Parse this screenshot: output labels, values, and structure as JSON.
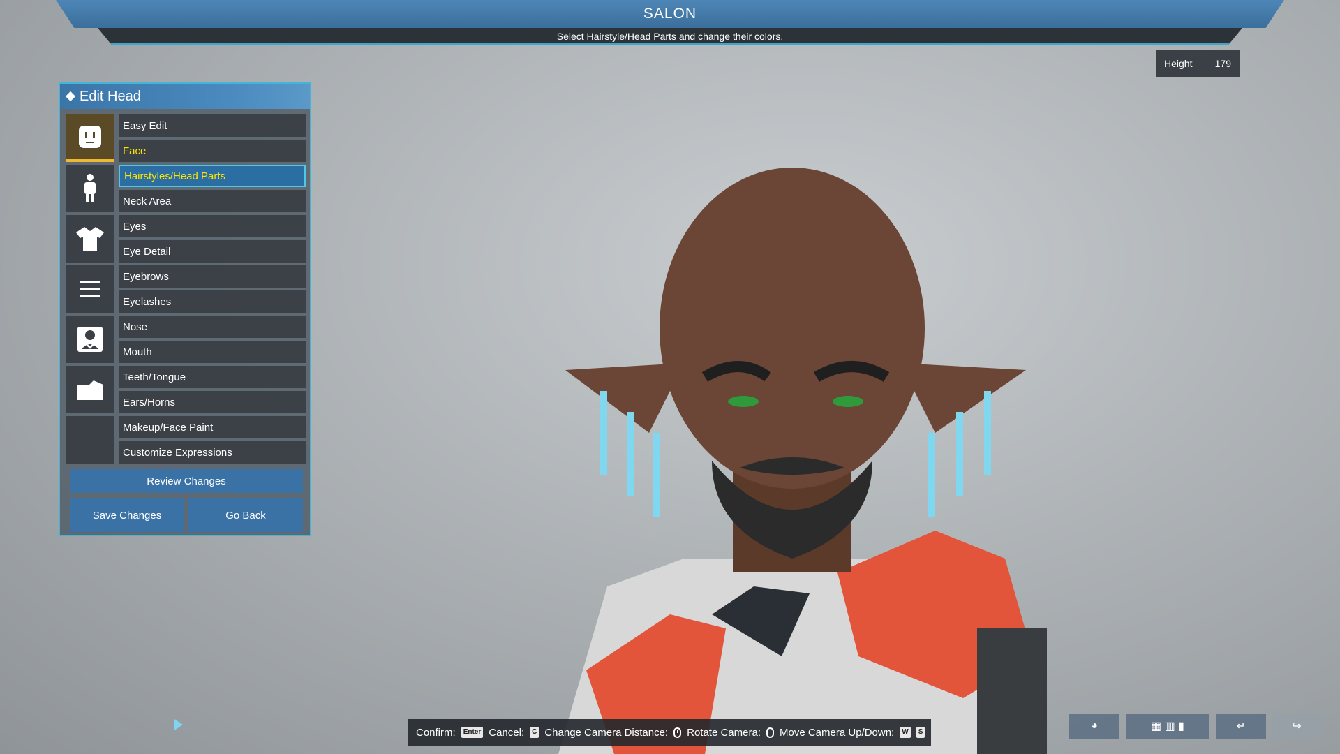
{
  "header": {
    "title": "SALON",
    "subtitle": "Select Hairstyle/Head Parts and change their colors."
  },
  "height": {
    "label": "Height",
    "value": "179"
  },
  "panel": {
    "title": "Edit Head",
    "menu": [
      "Easy Edit",
      "Face",
      "Hairstyles/Head Parts",
      "Neck Area",
      "Eyes",
      "Eye Detail",
      "Eyebrows",
      "Eyelashes",
      "Nose",
      "Mouth",
      "Teeth/Tongue",
      "Ears/Horns",
      "Makeup/Face Paint",
      "Customize Expressions"
    ],
    "review_label": "Review Changes",
    "save_label": "Save Changes",
    "back_label": "Go Back"
  },
  "controls": {
    "confirm": "Confirm:",
    "confirm_key": "Enter",
    "cancel": "Cancel:",
    "cancel_key": "C",
    "camera_distance": "Change Camera Distance:",
    "rotate": "Rotate Camera:",
    "move": "Move Camera Up/Down:",
    "move_key_w": "W",
    "move_key_s": "S"
  },
  "colors": {
    "accent": "#46b4d6",
    "highlight": "#ffe400",
    "button": "#3a72a6"
  }
}
